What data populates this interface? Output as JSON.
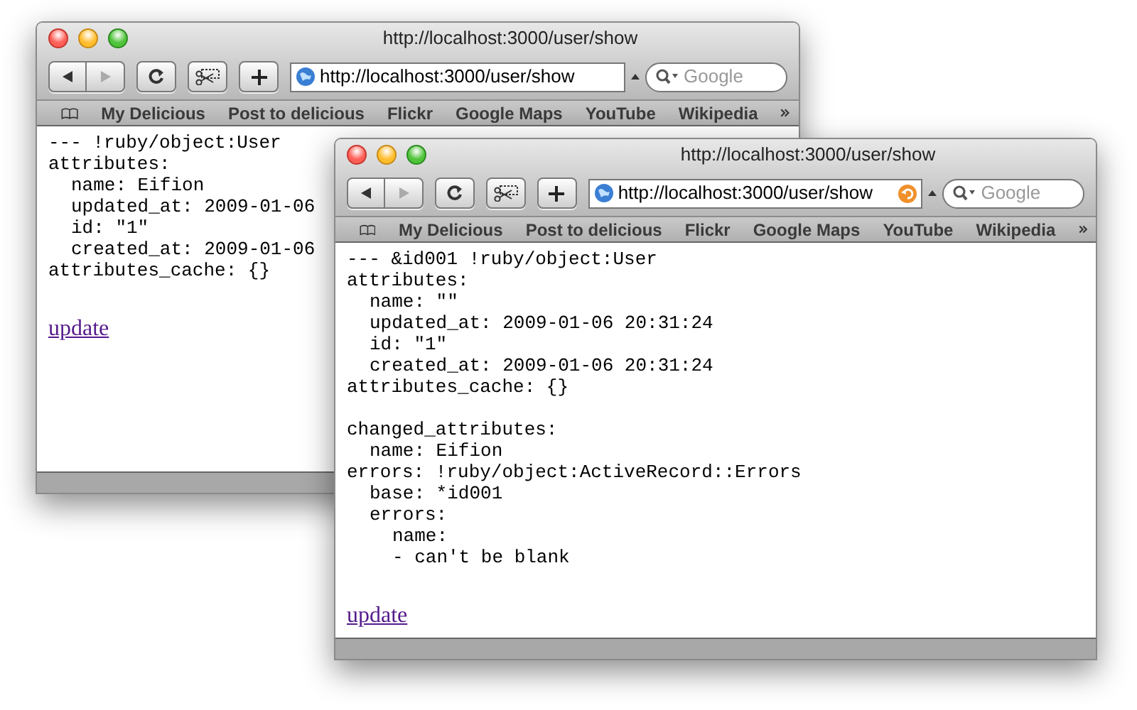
{
  "windows": [
    {
      "title": "http://localhost:3000/user/show",
      "url": "http://localhost:3000/user/show",
      "snapback": false,
      "search_placeholder": "Google",
      "bookmarks": [
        "My Delicious",
        "Post to delicious",
        "Flickr",
        "Google Maps",
        "YouTube",
        "Wikipedia"
      ],
      "blocks": [
        [
          {
            "text": "--- !ruby/object:User"
          },
          {
            "text": "attributes:",
            "children": [
              {
                "text": "name: Eifion"
              },
              {
                "text": "updated_at: 2009-01-06"
              },
              {
                "text": "id: \"1\""
              },
              {
                "text": "created_at: 2009-01-06"
              }
            ]
          },
          {
            "text": "attributes_cache: {}"
          }
        ]
      ],
      "link": "update"
    },
    {
      "title": "http://localhost:3000/user/show",
      "url": "http://localhost:3000/user/show",
      "snapback": true,
      "search_placeholder": "Google",
      "bookmarks": [
        "My Delicious",
        "Post to delicious",
        "Flickr",
        "Google Maps",
        "YouTube",
        "Wikipedia"
      ],
      "blocks": [
        [
          {
            "text": "--- &id001 !ruby/object:User"
          },
          {
            "text": "attributes:",
            "children": [
              {
                "text": "name: \"\""
              },
              {
                "text": "updated_at: 2009-01-06 20:31:24"
              },
              {
                "text": "id: \"1\""
              },
              {
                "text": "created_at: 2009-01-06 20:31:24"
              }
            ]
          },
          {
            "text": "attributes_cache: {}"
          }
        ],
        [
          {
            "text": "changed_attributes:",
            "children": [
              {
                "text": "name: Eifion"
              }
            ]
          },
          {
            "text": "errors: !ruby/object:ActiveRecord::Errors",
            "children": [
              {
                "text": "base: *id001"
              },
              {
                "text": "errors:",
                "children": [
                  {
                    "text": "name:"
                  },
                  {
                    "text": "- can't be blank"
                  }
                ]
              }
            ]
          }
        ]
      ],
      "link": "update"
    }
  ]
}
